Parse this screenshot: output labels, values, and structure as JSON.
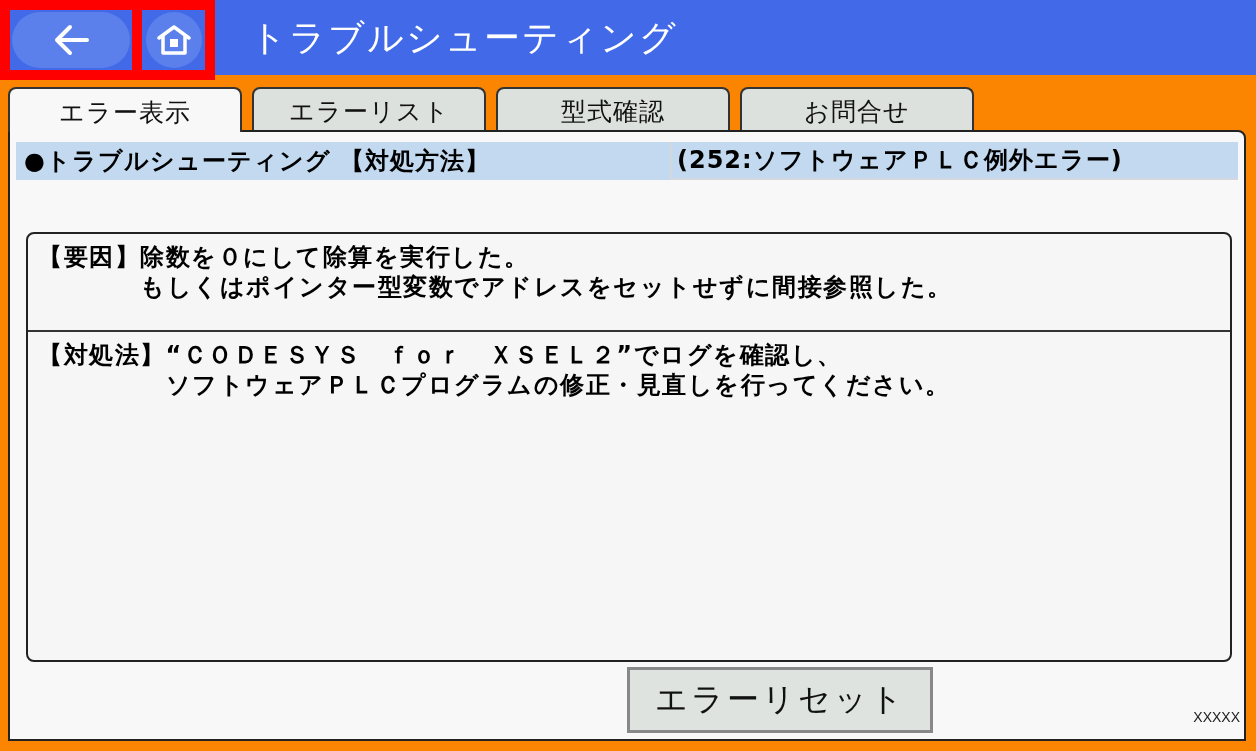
{
  "header": {
    "buttons": [
      {
        "kind": "back",
        "highlighted": true
      },
      {
        "kind": "home",
        "highlighted": true
      }
    ],
    "title": "トラブルシューティング"
  },
  "tabs": [
    {
      "label": "エラー表示",
      "selected": true
    },
    {
      "label": "エラーリスト",
      "selected": false
    },
    {
      "label": "型式確認",
      "selected": false
    },
    {
      "label": "お問合せ",
      "selected": false
    }
  ],
  "info_bar": {
    "heading": "●トラブルシューティング 【対処方法】",
    "error": "(252:ソフトウェアＰＬＣ例外エラー)"
  },
  "sections": [
    {
      "label": "【要因】",
      "lines": [
        "除数を０にして除算を実行した。",
        "もしくはポインター型変数でアドレスをセットせずに間接参照した。"
      ]
    },
    {
      "label": "【対処法】",
      "lines": [
        "“ＣＯＤＥＳＹＳ　ｆｏｒ　ＸＳＥＬ２”でログを確認し、",
        "ソフトウェアＰＬＣプログラムの修正・見直しを行ってください。"
      ]
    }
  ],
  "reset_button": "エラーリセット",
  "corner_text": "XXXXX"
}
